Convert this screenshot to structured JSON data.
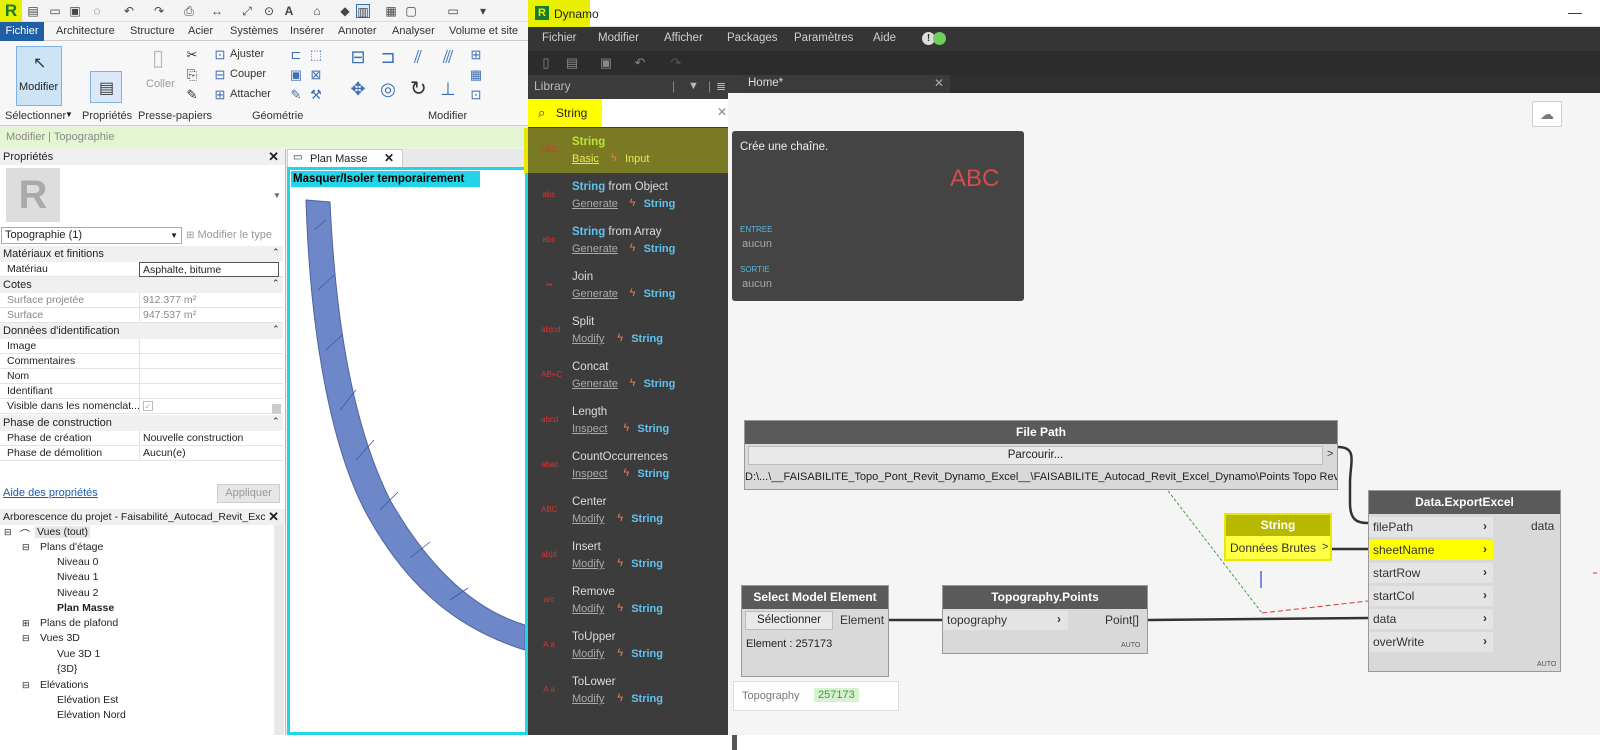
{
  "revit": {
    "logo": "R",
    "tabs": [
      "Fichier",
      "Architecture",
      "Structure",
      "Acier",
      "Systèmes",
      "Insérer",
      "Annoter",
      "Analyser",
      "Volume et site"
    ],
    "ribbon": {
      "modify_label": "Modifier",
      "coller_label": "Coller",
      "ajuster": "Ajuster",
      "couper": "Couper",
      "attacher": "Attacher",
      "panels": [
        "Sélectionner",
        "Propriétés",
        "Presse-papiers",
        "Géométrie",
        "Modifier"
      ]
    },
    "context_bar": "Modifier | Topographie",
    "properties": {
      "title": "Propriétés",
      "type_selector": "Topographie (1)",
      "edit_type": "Modifier le type",
      "sections": {
        "materials": "Matériaux et finitions",
        "dims": "Cotes",
        "identity": "Données d'identification",
        "phase": "Phase de construction"
      },
      "rows": {
        "materiau_k": "Matériau",
        "materiau_v": "Asphalte, bitume",
        "surf_proj_k": "Surface projetée",
        "surf_proj_v": "912.377 m²",
        "surface_k": "Surface",
        "surface_v": "947.537 m²",
        "image_k": "Image",
        "comment_k": "Commentaires",
        "nom_k": "Nom",
        "ident_k": "Identifiant",
        "visible_k": "Visible dans les nomenclat...",
        "phase_crea_k": "Phase de création",
        "phase_crea_v": "Nouvelle construction",
        "phase_demo_k": "Phase de démolition",
        "phase_demo_v": "Aucun(e)"
      },
      "help_link": "Aide des propriétés",
      "apply": "Appliquer"
    },
    "browser": {
      "title": "Arborescence du projet - Faisabilité_Autocad_Revit_Excel...",
      "items": [
        "Vues (tout)",
        "Plans d'étage",
        "Niveau 0",
        "Niveau 1",
        "Niveau 2",
        "Plan Masse",
        "Plans de plafond",
        "Vues 3D",
        "Vue 3D 1",
        "{3D}",
        "Elévations",
        "Elévation Est",
        "Elévation Nord"
      ]
    },
    "view": {
      "tab": "Plan Masse",
      "banner": "Masquer/Isoler temporairement"
    }
  },
  "dynamo": {
    "logo": "R",
    "title": "Dynamo",
    "menu": [
      "Fichier",
      "Modifier",
      "Afficher",
      "Packages",
      "Paramètres",
      "Aide"
    ],
    "library_title": "Library",
    "search_value": "String",
    "workspace_tab": "Home*",
    "results": [
      {
        "name": "String",
        "suffix": "",
        "cat": "Basic",
        "grp": "Input",
        "icon": "ABC"
      },
      {
        "name": "String",
        "suffix": " from Object",
        "cat": "Generate",
        "grp": "String",
        "icon": "abc"
      },
      {
        "name": "String",
        "suffix": " from Array",
        "cat": "Generate",
        "grp": "String",
        "icon": "abc"
      },
      {
        "name": "",
        "suffix": "Join",
        "cat": "Generate",
        "grp": "String",
        "icon": "↣"
      },
      {
        "name": "",
        "suffix": "Split",
        "cat": "Modify",
        "grp": "String",
        "icon": "ab|cd"
      },
      {
        "name": "",
        "suffix": "Concat",
        "cat": "Generate",
        "grp": "String",
        "icon": "AB+C"
      },
      {
        "name": "",
        "suffix": "Length",
        "cat": "Inspect",
        "grp": "String",
        "icon": "abcd"
      },
      {
        "name": "",
        "suffix": "CountOccurrences",
        "cat": "Inspect",
        "grp": "String",
        "icon": "abac"
      },
      {
        "name": "",
        "suffix": "Center",
        "cat": "Modify",
        "grp": "String",
        "icon": "ABC"
      },
      {
        "name": "",
        "suffix": "Insert",
        "cat": "Modify",
        "grp": "String",
        "icon": "ab|d"
      },
      {
        "name": "",
        "suffix": "Remove",
        "cat": "Modify",
        "grp": "String",
        "icon": "a/c"
      },
      {
        "name": "",
        "suffix": "ToUpper",
        "cat": "Modify",
        "grp": "String",
        "icon": "A a"
      },
      {
        "name": "",
        "suffix": "ToLower",
        "cat": "Modify",
        "grp": "String",
        "icon": "A a"
      }
    ],
    "tooltip": {
      "desc": "Crée une chaîne.",
      "icon": "ABC",
      "in_label": "ENTREE",
      "in_value": "aucun",
      "out_label": "SORTIE",
      "out_value": "aucun"
    },
    "nodes": {
      "filepath": {
        "title": "File Path",
        "button": "Parcourir...",
        "out": ">",
        "path": "D:\\...\\__FAISABILITE_Topo_Pont_Revit_Dynamo_Excel__\\FAISABILITE_Autocad_Revit_Excel_Dynamo\\Points Topo Revit"
      },
      "string": {
        "title": "String",
        "value": "Données Brutes",
        "out": ">"
      },
      "select": {
        "title": "Select Model Element",
        "button": "Sélectionner",
        "out": "Element",
        "info": "Element : 257173"
      },
      "topo": {
        "title": "Topography.Points",
        "in": "topography",
        "out": "Point[]",
        "auto": "AUTO"
      },
      "export": {
        "title": "Data.ExportExcel",
        "inputs": [
          "filePath",
          "sheetName",
          "startRow",
          "startCol",
          "data",
          "overWrite"
        ],
        "out": "data",
        "auto": "AUTO"
      }
    },
    "watch": {
      "label": "Topography",
      "value": "257173"
    }
  }
}
